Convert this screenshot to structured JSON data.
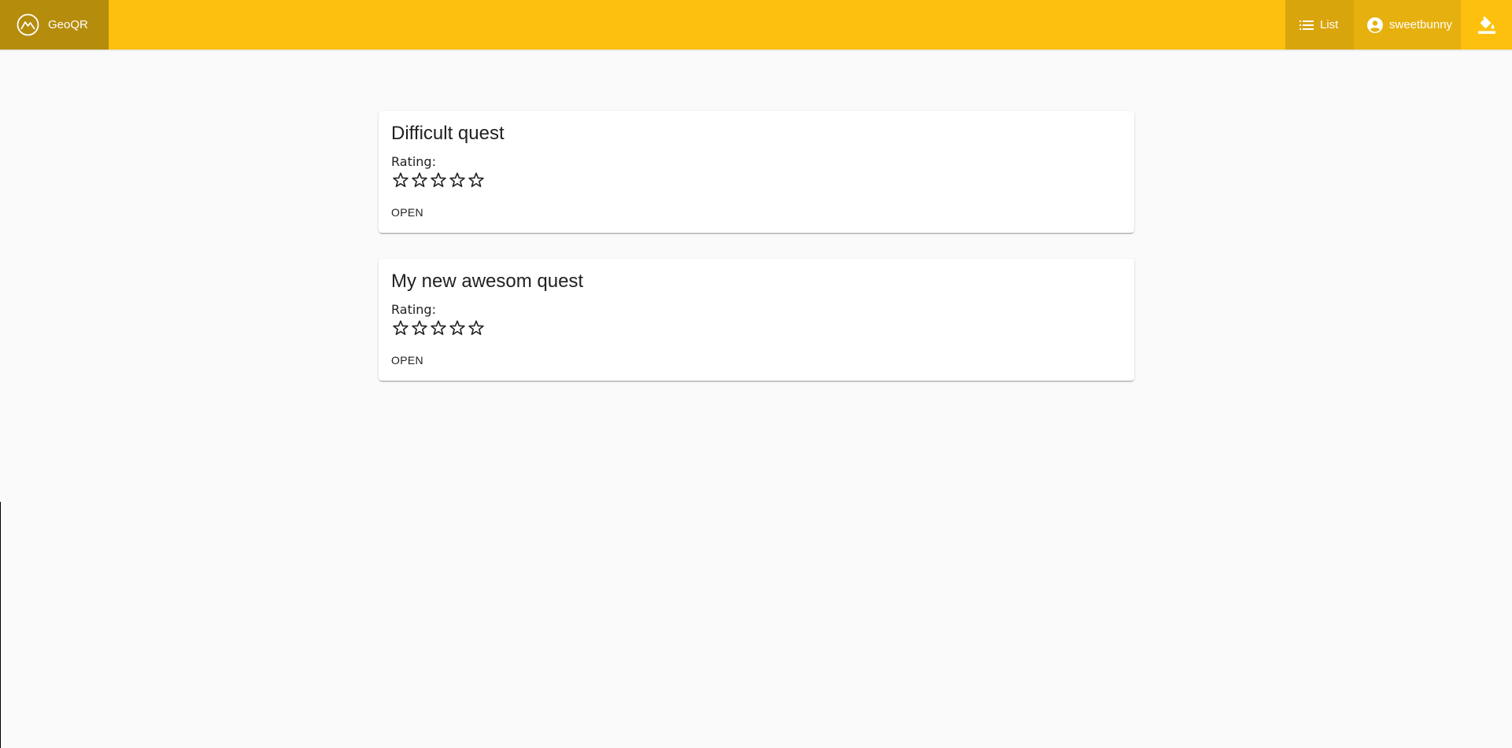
{
  "toolbar": {
    "brand": "GeoQR",
    "list_label": "List",
    "username": "sweetbunny",
    "colors": {
      "bar": "#fdc00f",
      "brand_bg": "#b58c0c",
      "list_bg": "#d9a50d",
      "user_bg": "#e6b00e"
    },
    "icons": [
      "mountain-logo-icon",
      "list-icon",
      "account-circle-icon",
      "format-color-fill-icon"
    ]
  },
  "quests": [
    {
      "title": "Difficult quest",
      "rating_label": "Rating:",
      "rating": 0,
      "max_rating": 5,
      "open_label": "OPEN"
    },
    {
      "title": "My new awesom quest",
      "rating_label": "Rating:",
      "rating": 0,
      "max_rating": 5,
      "open_label": "OPEN"
    }
  ]
}
